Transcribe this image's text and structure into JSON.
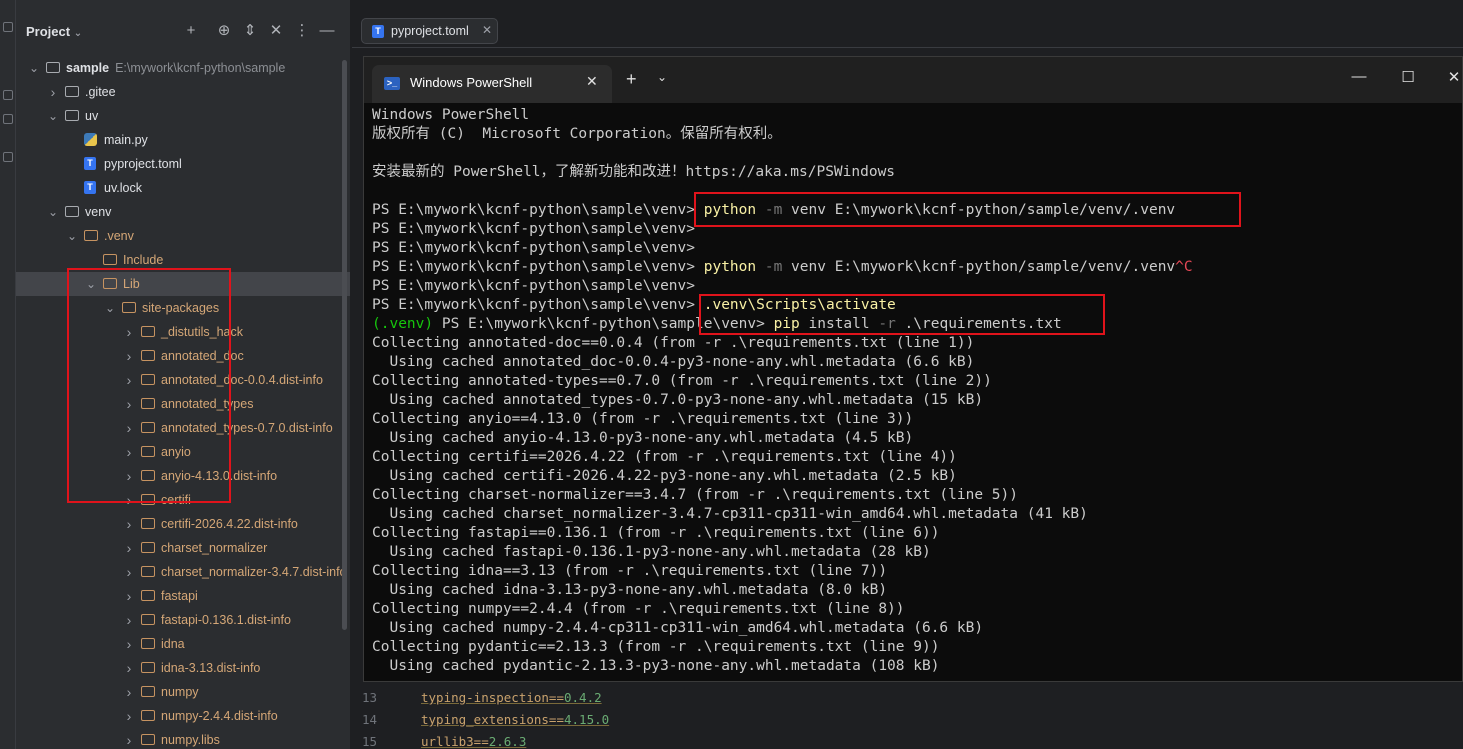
{
  "project": {
    "title": "Project",
    "tree": [
      {
        "label": "sample",
        "path": "E:\\mywork\\kcnf-python\\sample",
        "type": "folder",
        "open": true,
        "depth": 0,
        "bold": true
      },
      {
        "label": ".gitee",
        "type": "folder",
        "open": false,
        "depth": 1
      },
      {
        "label": "uv",
        "type": "folder",
        "open": true,
        "depth": 1
      },
      {
        "label": "main.py",
        "type": "py",
        "depth": 2
      },
      {
        "label": "pyproject.toml",
        "type": "toml",
        "depth": 2
      },
      {
        "label": "uv.lock",
        "type": "toml",
        "depth": 2
      },
      {
        "label": "venv",
        "type": "folder",
        "open": true,
        "depth": 1
      },
      {
        "label": ".venv",
        "type": "folder",
        "open": true,
        "depth": 2,
        "excluded": true
      },
      {
        "label": "Include",
        "type": "folder",
        "depth": 3,
        "excluded": true,
        "nochev": true
      },
      {
        "label": "Lib",
        "type": "folder",
        "open": true,
        "depth": 3,
        "excluded": true,
        "selected": true
      },
      {
        "label": "site-packages",
        "type": "folder",
        "open": true,
        "depth": 4,
        "excluded": true
      },
      {
        "label": "_distutils_hack",
        "type": "folder",
        "open": false,
        "depth": 5,
        "excluded": true
      },
      {
        "label": "annotated_doc",
        "type": "folder",
        "open": false,
        "depth": 5,
        "excluded": true
      },
      {
        "label": "annotated_doc-0.0.4.dist-info",
        "type": "folder",
        "open": false,
        "depth": 5,
        "excluded": true
      },
      {
        "label": "annotated_types",
        "type": "folder",
        "open": false,
        "depth": 5,
        "excluded": true
      },
      {
        "label": "annotated_types-0.7.0.dist-info",
        "type": "folder",
        "open": false,
        "depth": 5,
        "excluded": true
      },
      {
        "label": "anyio",
        "type": "folder",
        "open": false,
        "depth": 5,
        "excluded": true
      },
      {
        "label": "anyio-4.13.0.dist-info",
        "type": "folder",
        "open": false,
        "depth": 5,
        "excluded": true
      },
      {
        "label": "certifi",
        "type": "folder",
        "open": false,
        "depth": 5,
        "excluded": true
      },
      {
        "label": "certifi-2026.4.22.dist-info",
        "type": "folder",
        "open": false,
        "depth": 5,
        "excluded": true
      },
      {
        "label": "charset_normalizer",
        "type": "folder",
        "open": false,
        "depth": 5,
        "excluded": true
      },
      {
        "label": "charset_normalizer-3.4.7.dist-info",
        "type": "folder",
        "open": false,
        "depth": 5,
        "excluded": true
      },
      {
        "label": "fastapi",
        "type": "folder",
        "open": false,
        "depth": 5,
        "excluded": true
      },
      {
        "label": "fastapi-0.136.1.dist-info",
        "type": "folder",
        "open": false,
        "depth": 5,
        "excluded": true
      },
      {
        "label": "idna",
        "type": "folder",
        "open": false,
        "depth": 5,
        "excluded": true
      },
      {
        "label": "idna-3.13.dist-info",
        "type": "folder",
        "open": false,
        "depth": 5,
        "excluded": true
      },
      {
        "label": "numpy",
        "type": "folder",
        "open": false,
        "depth": 5,
        "excluded": true
      },
      {
        "label": "numpy-2.4.4.dist-info",
        "type": "folder",
        "open": false,
        "depth": 5,
        "excluded": true
      },
      {
        "label": "numpy.libs",
        "type": "folder",
        "open": false,
        "depth": 5,
        "excluded": true
      }
    ]
  },
  "editor": {
    "tab_label": "pyproject.toml",
    "lines": [
      {
        "no": "13",
        "name": "typing-inspection==",
        "ver": "0.4.2"
      },
      {
        "no": "14",
        "name": "typing_extensions==",
        "ver": "4.15.0"
      },
      {
        "no": "15",
        "name": "urllib3==",
        "ver": "2.6.3"
      }
    ]
  },
  "terminal": {
    "tab_title": "Windows PowerShell",
    "lines": [
      [
        {
          "t": "Windows PowerShell"
        }
      ],
      [
        {
          "t": "版权所有 (C)  Microsoft Corporation。保留所有权利。"
        }
      ],
      [
        {
          "t": ""
        }
      ],
      [
        {
          "t": "安装最新的 PowerShell，了解新功能和改进！https://aka.ms/PSWindows"
        }
      ],
      [
        {
          "t": ""
        }
      ],
      [
        {
          "t": "PS E:\\mywork\\kcnf-python\\sample\\venv> "
        },
        {
          "t": "python",
          "c": "ky"
        },
        {
          "t": " -m",
          "c": "gr"
        },
        {
          "t": " venv E:\\mywork\\kcnf-python/sample/venv/.venv"
        }
      ],
      [
        {
          "t": "PS E:\\mywork\\kcnf-python\\sample\\venv>"
        }
      ],
      [
        {
          "t": "PS E:\\mywork\\kcnf-python\\sample\\venv>"
        }
      ],
      [
        {
          "t": "PS E:\\mywork\\kcnf-python\\sample\\venv> "
        },
        {
          "t": "python",
          "c": "ky"
        },
        {
          "t": " -m",
          "c": "gr"
        },
        {
          "t": " venv E:\\mywork\\kcnf-python/sample/venv/.venv"
        },
        {
          "t": "^C",
          "c": "rd"
        }
      ],
      [
        {
          "t": "PS E:\\mywork\\kcnf-python\\sample\\venv>"
        }
      ],
      [
        {
          "t": "PS E:\\mywork\\kcnf-python\\sample\\venv> "
        },
        {
          "t": ".venv\\Scripts\\activate",
          "c": "ky"
        }
      ],
      [
        {
          "t": "(.venv)",
          "c": "gn"
        },
        {
          "t": " PS E:\\mywork\\kcnf-python\\sample\\venv> "
        },
        {
          "t": "pip",
          "c": "ky"
        },
        {
          "t": " install"
        },
        {
          "t": " -r",
          "c": "gr"
        },
        {
          "t": " .\\requirements.txt"
        }
      ],
      [
        {
          "t": "Collecting annotated-doc==0.0.4 (from -r .\\requirements.txt (line 1))"
        }
      ],
      [
        {
          "t": "  Using cached annotated_doc-0.0.4-py3-none-any.whl.metadata (6.6 kB)"
        }
      ],
      [
        {
          "t": "Collecting annotated-types==0.7.0 (from -r .\\requirements.txt (line 2))"
        }
      ],
      [
        {
          "t": "  Using cached annotated_types-0.7.0-py3-none-any.whl.metadata (15 kB)"
        }
      ],
      [
        {
          "t": "Collecting anyio==4.13.0 (from -r .\\requirements.txt (line 3))"
        }
      ],
      [
        {
          "t": "  Using cached anyio-4.13.0-py3-none-any.whl.metadata (4.5 kB)"
        }
      ],
      [
        {
          "t": "Collecting certifi==2026.4.22 (from -r .\\requirements.txt (line 4))"
        }
      ],
      [
        {
          "t": "  Using cached certifi-2026.4.22-py3-none-any.whl.metadata (2.5 kB)"
        }
      ],
      [
        {
          "t": "Collecting charset-normalizer==3.4.7 (from -r .\\requirements.txt (line 5))"
        }
      ],
      [
        {
          "t": "  Using cached charset_normalizer-3.4.7-cp311-cp311-win_amd64.whl.metadata (41 kB)"
        }
      ],
      [
        {
          "t": "Collecting fastapi==0.136.1 (from -r .\\requirements.txt (line 6))"
        }
      ],
      [
        {
          "t": "  Using cached fastapi-0.136.1-py3-none-any.whl.metadata (28 kB)"
        }
      ],
      [
        {
          "t": "Collecting idna==3.13 (from -r .\\requirements.txt (line 7))"
        }
      ],
      [
        {
          "t": "  Using cached idna-3.13-py3-none-any.whl.metadata (8.0 kB)"
        }
      ],
      [
        {
          "t": "Collecting numpy==2.4.4 (from -r .\\requirements.txt (line 8))"
        }
      ],
      [
        {
          "t": "  Using cached numpy-2.4.4-cp311-cp311-win_amd64.whl.metadata (6.6 kB)"
        }
      ],
      [
        {
          "t": "Collecting pydantic==2.13.3 (from -r .\\requirements.txt (line 9))"
        }
      ],
      [
        {
          "t": "  Using cached pydantic-2.13.3-py3-none-any.whl.metadata (108 kB)"
        }
      ]
    ]
  },
  "colors": {
    "highlight": "#e0131b",
    "ps_keyword": "#f9f1a5",
    "ps_venv": "#16c60c",
    "excluded_folder": "#d5a777"
  }
}
